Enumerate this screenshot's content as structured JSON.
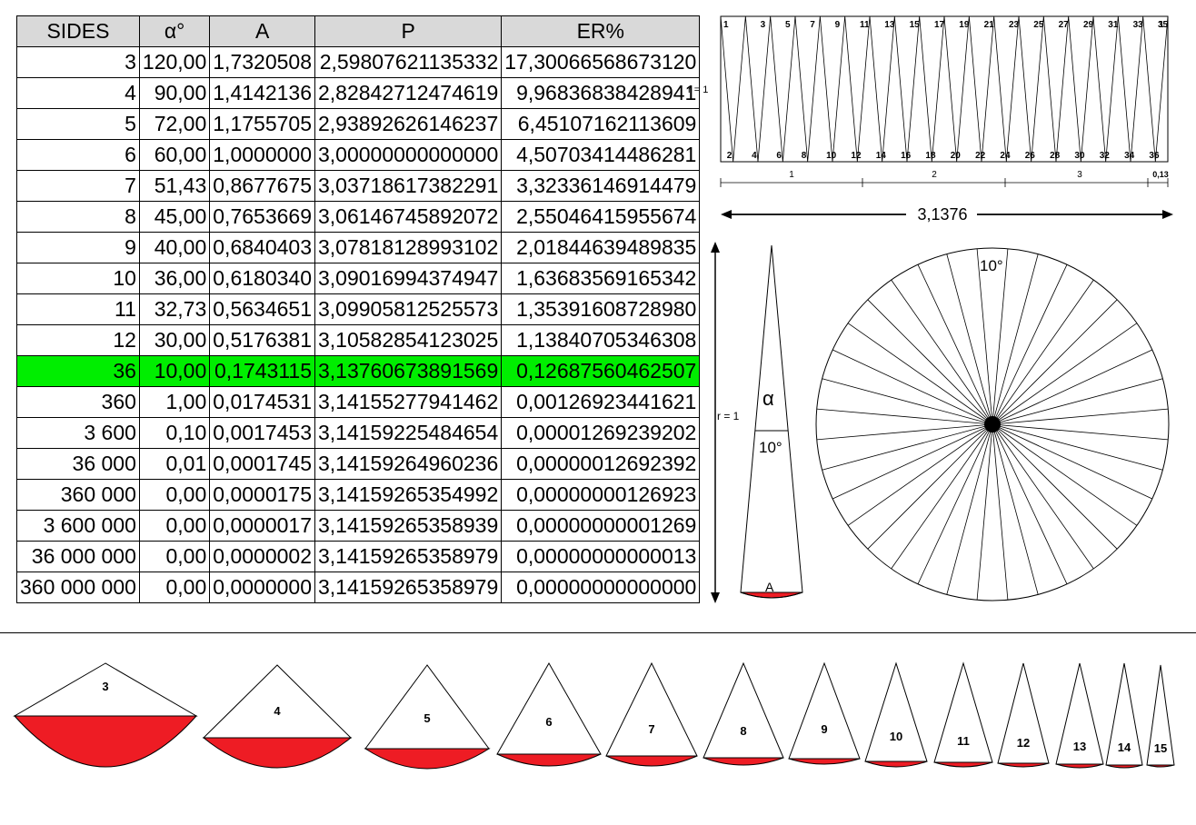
{
  "table": {
    "headers": [
      "SIDES",
      "α°",
      "A",
      "P",
      "ER%"
    ],
    "highlight_color": "#00ee00",
    "rows": [
      [
        "3",
        "120,00",
        "1,7320508",
        "2,59807621135332",
        "17,30066568673120"
      ],
      [
        "4",
        "90,00",
        "1,4142136",
        "2,82842712474619",
        "9,96836838428941"
      ],
      [
        "5",
        "72,00",
        "1,1755705",
        "2,93892626146237",
        "6,45107162113609"
      ],
      [
        "6",
        "60,00",
        "1,0000000",
        "3,00000000000000",
        "4,50703414486281"
      ],
      [
        "7",
        "51,43",
        "0,8677675",
        "3,03718617382291",
        "3,32336146914479"
      ],
      [
        "8",
        "45,00",
        "0,7653669",
        "3,06146745892072",
        "2,55046415955674"
      ],
      [
        "9",
        "40,00",
        "0,6840403",
        "3,07818128993102",
        "2,01844639489835"
      ],
      [
        "10",
        "36,00",
        "0,6180340",
        "3,09016994374947",
        "1,63683569165342"
      ],
      [
        "11",
        "32,73",
        "0,5634651",
        "3,09905812525573",
        "1,35391608728980"
      ],
      [
        "12",
        "30,00",
        "0,5176381",
        "3,10582854123025",
        "1,13840705346308"
      ],
      [
        "36",
        "10,00",
        "0,1743115",
        "3,13760673891569",
        "0,12687560462507"
      ],
      [
        "360",
        "1,00",
        "0,0174531",
        "3,14155277941462",
        "0,00126923441621"
      ],
      [
        "3 600",
        "0,10",
        "0,0017453",
        "3,14159225484654",
        "0,00001269239202"
      ],
      [
        "36 000",
        "0,01",
        "0,0001745",
        "3,14159264960236",
        "0,00000012692392"
      ],
      [
        "360 000",
        "0,00",
        "0,0000175",
        "3,14159265354992",
        "0,00000000126923"
      ],
      [
        "3 600 000",
        "0,00",
        "0,0000017",
        "3,14159265358939",
        "0,00000000001269"
      ],
      [
        "36 000 000",
        "0,00",
        "0,0000002",
        "3,14159265358979",
        "0,00000000000013"
      ],
      [
        "360 000 000",
        "0,00",
        "0,0000000",
        "3,14159265358979",
        "0,00000000000000"
      ]
    ],
    "highlight_row": 10
  },
  "strip": {
    "r_label": "r = 1",
    "top_numbers": [
      "1",
      "3",
      "5",
      "7",
      "9",
      "11",
      "13",
      "15",
      "17",
      "19",
      "21",
      "23",
      "25",
      "27",
      "29",
      "31",
      "33",
      "35",
      "1"
    ],
    "bottom_numbers": [
      "2",
      "4",
      "6",
      "8",
      "10",
      "12",
      "14",
      "16",
      "18",
      "20",
      "22",
      "24",
      "26",
      "28",
      "30",
      "32",
      "34",
      "36"
    ],
    "ruler_labels": [
      "1",
      "2",
      "3",
      "0,13"
    ],
    "total_length": "3,1376"
  },
  "wedge": {
    "r_label": "r = 1",
    "alpha_label": "α",
    "angle_label": "10°",
    "area_label": "A"
  },
  "circle": {
    "angle_label": "10°",
    "sectors": 36
  },
  "triangles": {
    "labels": [
      "3",
      "4",
      "5",
      "6",
      "7",
      "8",
      "9",
      "10",
      "11",
      "12",
      "13",
      "14",
      "15"
    ],
    "fill_color": "#ee1c24"
  }
}
